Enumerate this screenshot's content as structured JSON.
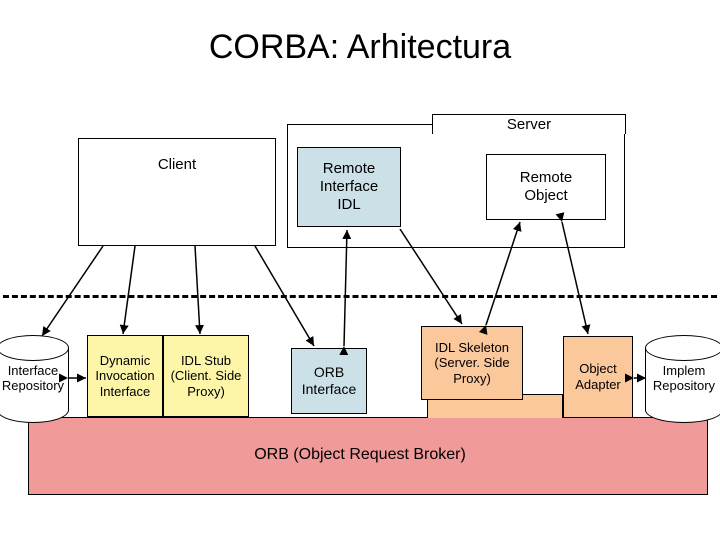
{
  "title": "CORBA: Arhitectura",
  "top": {
    "server_label": "Server",
    "client": "Client",
    "remote_idl": "Remote\nInterface\nIDL",
    "remote_obj": "Remote\nObject"
  },
  "mid": {
    "interface_repo": "Interface\nRepository",
    "dyn_invoc": "Dynamic\nInvocation\nInterface",
    "idl_stub": "IDL Stub\n(Client. Side\nProxy)",
    "orb_if": "ORB\nInterface",
    "idl_skel": "IDL Skeleton\n(Server. Side\nProxy)",
    "obj_adapter": "Object\nAdapter",
    "implem_repo": "Implem\nRepository"
  },
  "orb_label": "ORB (Object Request Broker)",
  "colors": {
    "blue": "#cce0e8",
    "yellow": "#fdf6a9",
    "orange": "#fbc89b",
    "red": "#f09a9a"
  }
}
